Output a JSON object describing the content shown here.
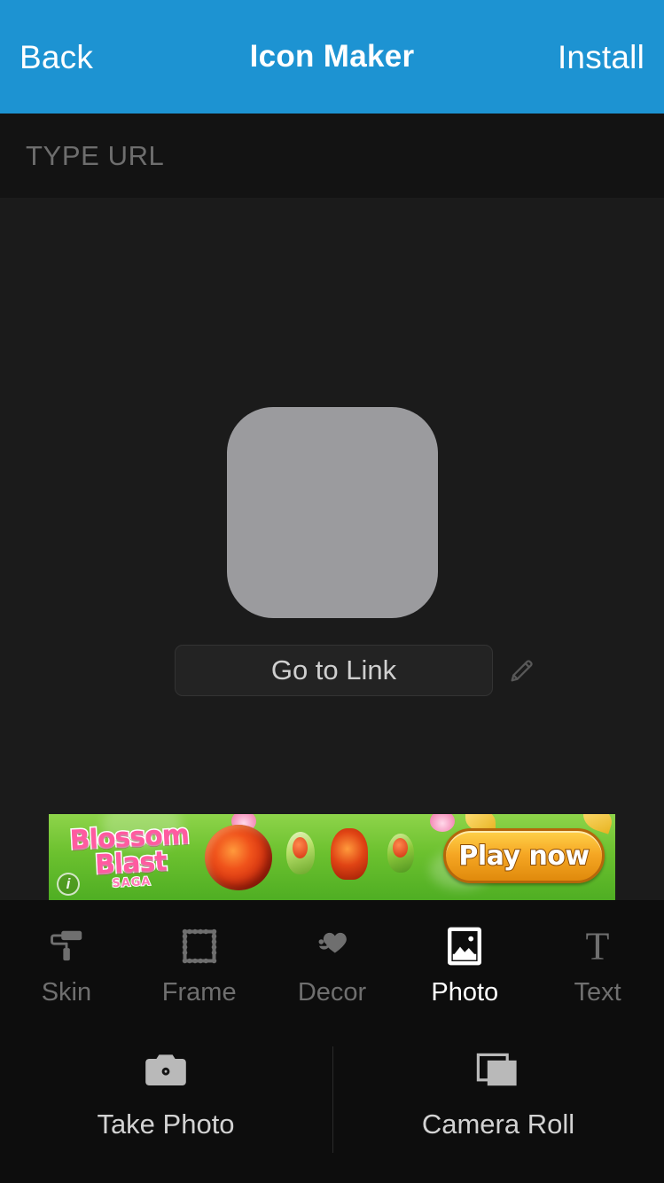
{
  "header": {
    "back_label": "Back",
    "title": "Icon Maker",
    "install_label": "Install",
    "background_color": "#1d93d2"
  },
  "url_bar": {
    "placeholder": "TYPE URL",
    "value": ""
  },
  "canvas": {
    "icon_preview_color": "#9b9b9e",
    "link_label": "Go to Link",
    "edit_icon": "pencil-icon"
  },
  "ad": {
    "title_line1": "Blossom",
    "title_line2": "Blast",
    "subtitle": "SAGA",
    "cta_label": "Play now",
    "info_badge": "i"
  },
  "tabs": [
    {
      "label": "Skin",
      "icon": "paint-roller-icon",
      "active": false
    },
    {
      "label": "Frame",
      "icon": "picture-frame-icon",
      "active": false
    },
    {
      "label": "Decor",
      "icon": "smiley-heart-icon",
      "active": false
    },
    {
      "label": "Photo",
      "icon": "photo-image-icon",
      "active": true
    },
    {
      "label": "Text",
      "icon": "text-t-icon",
      "active": false
    }
  ],
  "photo_sources": [
    {
      "label": "Take Photo",
      "icon": "camera-icon"
    },
    {
      "label": "Camera Roll",
      "icon": "photo-stack-icon"
    }
  ],
  "colors": {
    "accent": "#1d93d2",
    "canvas_bg": "#1b1b1b",
    "panel_bg": "#0d0d0d",
    "inactive_text": "#6f6f6f",
    "active_text": "#ffffff"
  }
}
